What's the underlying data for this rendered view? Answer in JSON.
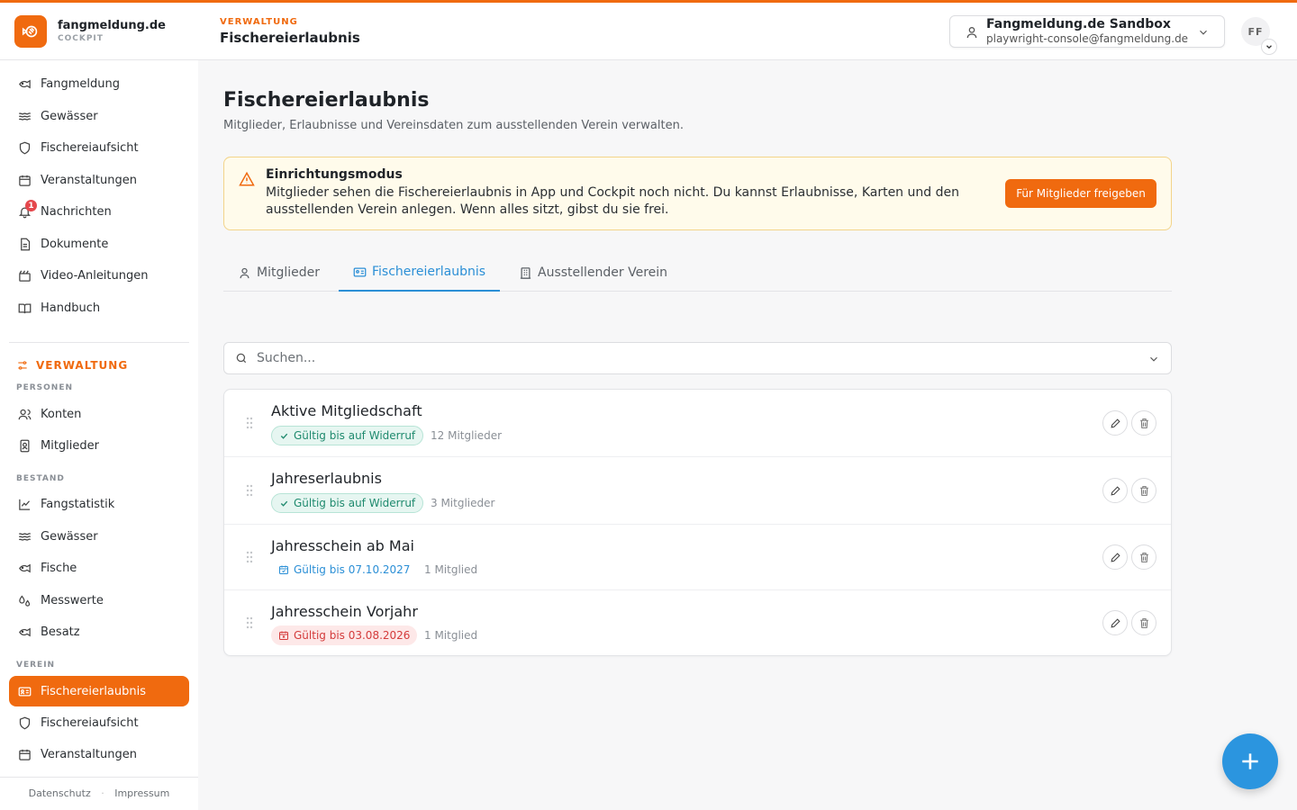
{
  "brand": {
    "name": "fangmeldung.de",
    "sub": "COCKPIT"
  },
  "header": {
    "section": "VERWALTUNG",
    "title": "Fischereierlaubnis",
    "account": {
      "org": "Fangmeldung.de Sandbox",
      "email": "playwright-console@fangmeldung.de"
    },
    "avatar": "FF"
  },
  "sidebar": {
    "main_items": [
      {
        "label": "Fangmeldung",
        "icon": "fish-icon"
      },
      {
        "label": "Gewässer",
        "icon": "waves-icon"
      },
      {
        "label": "Fischereiaufsicht",
        "icon": "shield-icon"
      },
      {
        "label": "Veranstaltungen",
        "icon": "calendar-icon"
      },
      {
        "label": "Nachrichten",
        "icon": "bell-icon",
        "badge": "1"
      },
      {
        "label": "Dokumente",
        "icon": "document-icon"
      },
      {
        "label": "Video-Anleitungen",
        "icon": "video-icon"
      },
      {
        "label": "Handbuch",
        "icon": "book-icon"
      }
    ],
    "admin_header": "VERWALTUNG",
    "groups": {
      "personen": "PERSONEN",
      "bestand": "BESTAND",
      "verein": "VEREIN"
    },
    "personen_items": [
      {
        "label": "Konten",
        "icon": "users-icon"
      },
      {
        "label": "Mitglieder",
        "icon": "member-card-icon"
      }
    ],
    "bestand_items": [
      {
        "label": "Fangstatistik",
        "icon": "chart-line-icon"
      },
      {
        "label": "Gewässer",
        "icon": "waves-icon"
      },
      {
        "label": "Fische",
        "icon": "fish-icon"
      },
      {
        "label": "Messwerte",
        "icon": "droplets-icon"
      },
      {
        "label": "Besatz",
        "icon": "fish-icon"
      }
    ],
    "verein_items": [
      {
        "label": "Fischereierlaubnis",
        "icon": "id-card-icon",
        "active": true
      },
      {
        "label": "Fischereiaufsicht",
        "icon": "shield-icon"
      },
      {
        "label": "Veranstaltungen",
        "icon": "calendar-icon"
      }
    ],
    "footer": {
      "privacy": "Datenschutz",
      "separator": "·",
      "imprint": "Impressum"
    }
  },
  "page": {
    "title": "Fischereierlaubnis",
    "subtitle": "Mitglieder, Erlaubnisse und Vereinsdaten zum ausstellenden Verein verwalten."
  },
  "alert": {
    "title": "Einrichtungsmodus",
    "text": "Mitglieder sehen die Fischereierlaubnis in App und Cockpit noch nicht. Du kannst Erlaubnisse, Karten und den ausstellenden Verein anlegen. Wenn alles sitzt, gibst du sie frei.",
    "button": "Für Mitglieder freigeben"
  },
  "tabs": [
    {
      "label": "Mitglieder",
      "icon": "user-icon"
    },
    {
      "label": "Fischereierlaubnis",
      "icon": "id-card-icon",
      "active": true
    },
    {
      "label": "Ausstellender Verein",
      "icon": "building-icon"
    }
  ],
  "search": {
    "placeholder": "Suchen..."
  },
  "permits": [
    {
      "title": "Aktive Mitgliedschaft",
      "validity": "Gültig bis auf Widerruf",
      "status": "unlimited",
      "count": "12 Mitglieder"
    },
    {
      "title": "Jahreserlaubnis",
      "validity": "Gültig bis auf Widerruf",
      "status": "unlimited",
      "count": "3 Mitglieder"
    },
    {
      "title": "Jahresschein ab Mai",
      "validity": "Gültig bis 07.10.2027",
      "status": "date",
      "count": "1 Mitglied"
    },
    {
      "title": "Jahresschein Vorjahr",
      "validity": "Gültig bis 03.08.2026",
      "status": "expiring",
      "count": "1 Mitglied"
    }
  ],
  "colors": {
    "accent": "#f06a0f",
    "link": "#2b8fd6",
    "success": "#1f8a6e",
    "danger": "#d43b3b"
  }
}
